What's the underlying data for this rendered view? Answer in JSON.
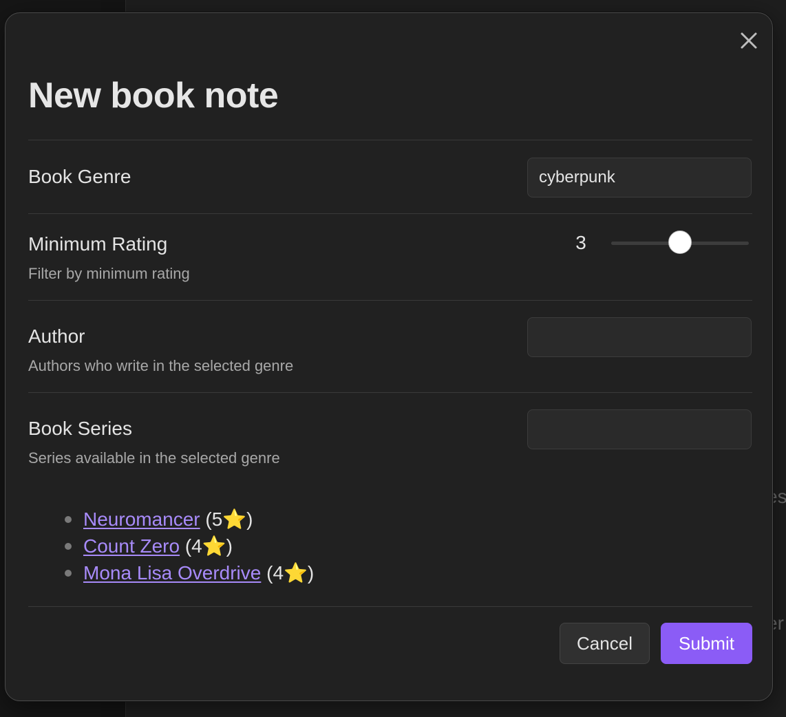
{
  "background": {
    "ghost_text_1": "es",
    "ghost_text_2": "er"
  },
  "modal": {
    "title": "New book note",
    "close_icon": "close-icon",
    "fields": {
      "genre": {
        "label": "Book Genre",
        "value": "cyberpunk",
        "placeholder": ""
      },
      "rating": {
        "label": "Minimum Rating",
        "description": "Filter by minimum rating",
        "value": "3",
        "min": 1,
        "max": 5
      },
      "author": {
        "label": "Author",
        "description": "Authors who write in the selected genre",
        "value": "",
        "placeholder": ""
      },
      "series": {
        "label": "Book Series",
        "description": "Series available in the selected genre",
        "value": "",
        "placeholder": ""
      }
    },
    "series_list": [
      {
        "title": "Neuromancer",
        "rating": "(5⭐)"
      },
      {
        "title": "Count Zero",
        "rating": "(4⭐)"
      },
      {
        "title": "Mona Lisa Overdrive",
        "rating": "(4⭐)"
      }
    ],
    "buttons": {
      "cancel": "Cancel",
      "submit": "Submit"
    }
  },
  "colors": {
    "accent": "#8b5cf6",
    "link": "#a88bfa",
    "modal_bg": "#212121"
  }
}
